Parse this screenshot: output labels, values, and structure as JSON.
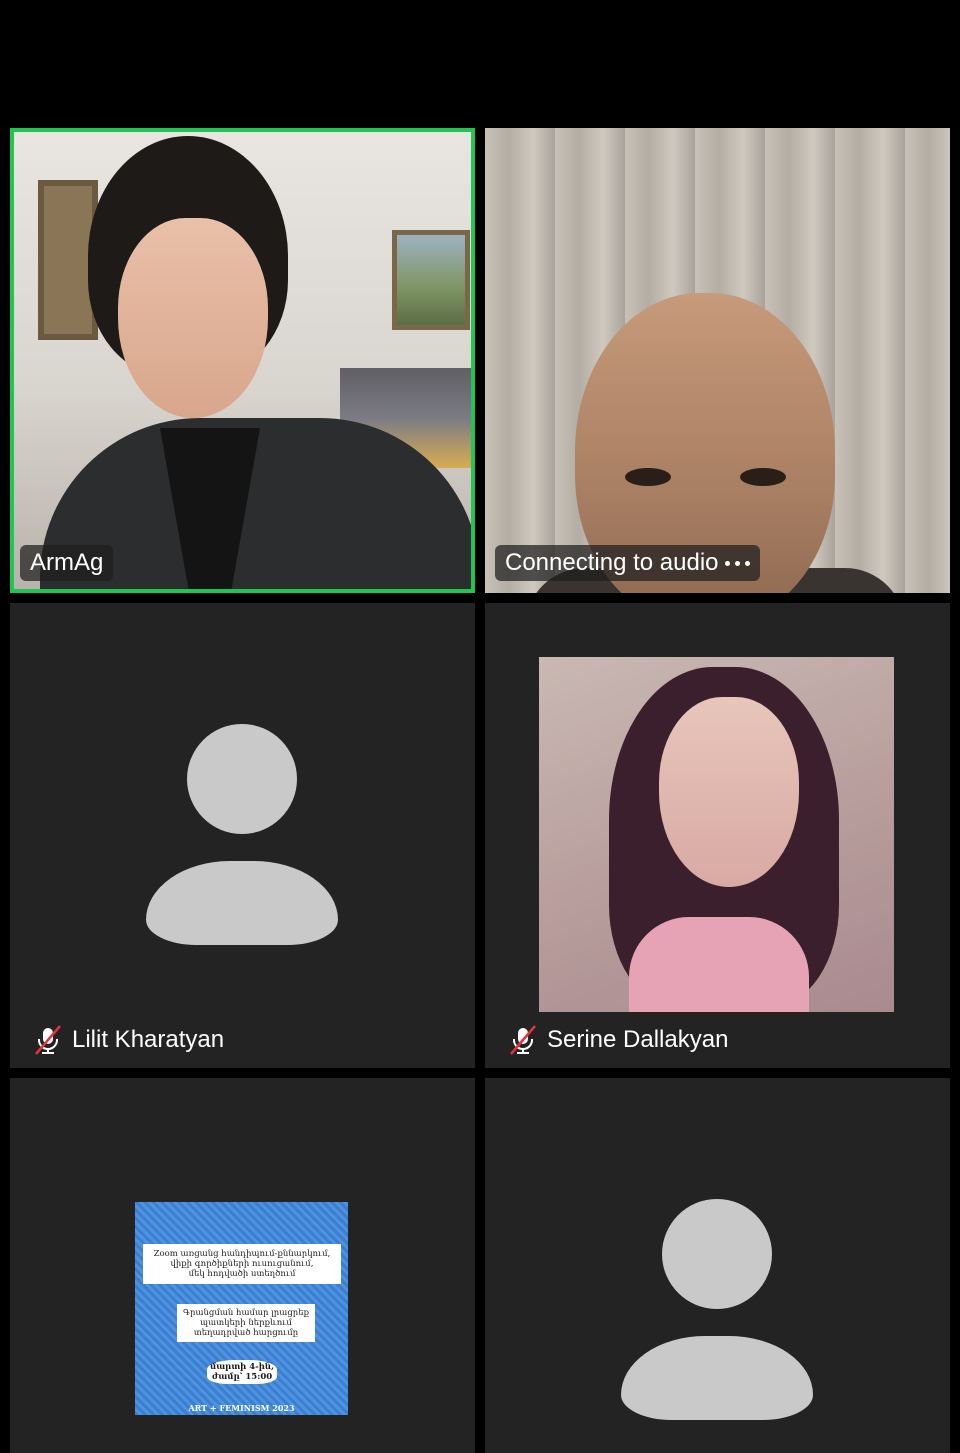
{
  "participants": [
    {
      "name": "ArmAg",
      "type": "video",
      "active_speaker": true,
      "muted": false
    },
    {
      "name": "Connecting to audio",
      "type": "video",
      "active_speaker": false,
      "muted": false
    },
    {
      "name": "Lilit Kharatyan",
      "type": "avatar",
      "active_speaker": false,
      "muted": true
    },
    {
      "name": "Serine Dallakyan",
      "type": "profile-photo",
      "active_speaker": false,
      "muted": true
    },
    {
      "name": "",
      "type": "poster",
      "active_speaker": false,
      "muted": false
    },
    {
      "name": "",
      "type": "avatar",
      "active_speaker": false,
      "muted": false
    }
  ],
  "poster": {
    "line1": "Zoom առցանց հանդիպում-քննարկում,",
    "line2": "վիքի գործիքների ուսուցանում,",
    "line3": "մեկ հոդվածի ստեղծում",
    "line4": "Գրանցման համար լրացրեք",
    "line5": "պատկերի ներքևում",
    "line6": "տեղադրված հարցումը",
    "date_line1": "մարտի 4-ին,",
    "date_line2": "ժամը՝ 15:00",
    "footer": "ART + FEMINISM 2023"
  },
  "colors": {
    "active_speaker_border": "#23c552",
    "tile_background": "#232323",
    "app_background": "#000000",
    "avatar_color": "#c9c9c9",
    "muted_slash": "#e0343c"
  }
}
